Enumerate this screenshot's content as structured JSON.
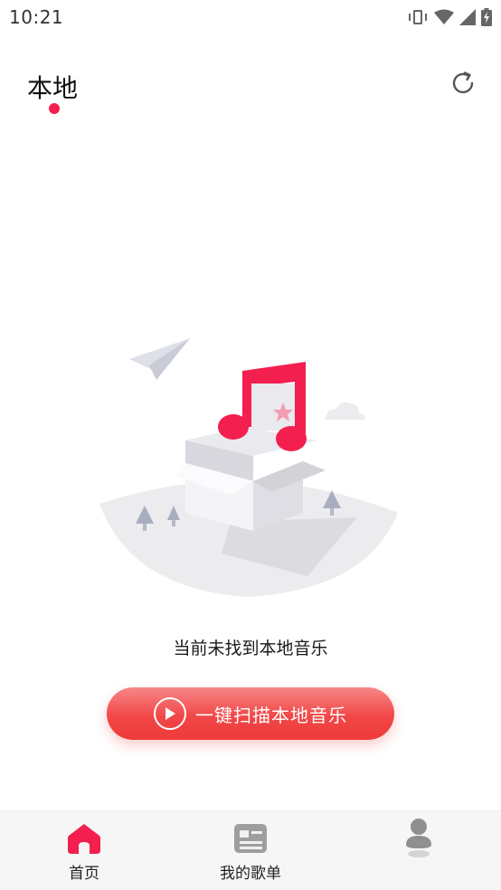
{
  "status_bar": {
    "time": "10:21",
    "icons": [
      "vibrate-icon",
      "wifi-icon",
      "signal-icon",
      "battery-charging-icon"
    ]
  },
  "header": {
    "title": "本地",
    "refresh_icon": "refresh-icon"
  },
  "empty_state": {
    "illustration": "music-box-illustration",
    "message": "当前未找到本地音乐"
  },
  "scan_button": {
    "icon": "play-circle-icon",
    "label": "一键扫描本地音乐"
  },
  "tab_bar": {
    "tabs": [
      {
        "label": "首页",
        "icon": "home-icon",
        "active": true
      },
      {
        "label": "我的歌单",
        "icon": "playlist-icon",
        "active": false
      },
      {
        "label": "",
        "icon": "profile-icon",
        "active": false
      }
    ]
  },
  "colors": {
    "accent": "#f21f4f",
    "button_gradient_top": "#f78787",
    "button_gradient_bottom": "#ee3a3a",
    "tab_bar_bg": "#f6f6f6"
  }
}
